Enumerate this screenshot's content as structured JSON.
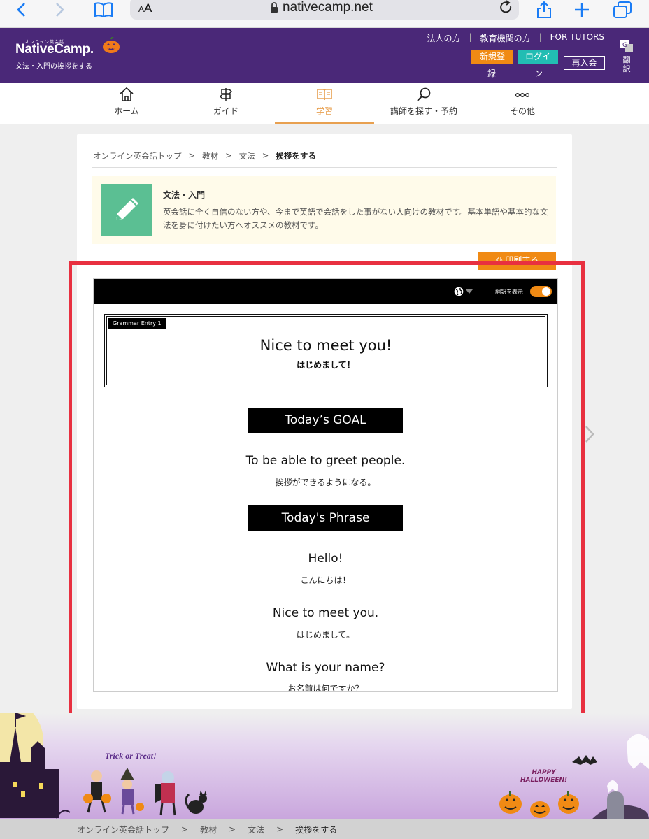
{
  "browser": {
    "aa_label": "AA",
    "url": "nativecamp.net"
  },
  "header": {
    "logo_small": "オンライン英会話",
    "logo_text": "NativeCamp.",
    "page_subtitle": "文法・入門の挨拶をする",
    "links": [
      "法人の方",
      "教育機関の方",
      "FOR TUTORS"
    ],
    "register_label_1": "新規登",
    "register_label_2": "録",
    "login_label_1": "ログイ",
    "login_label_2": "ン",
    "rejoin_label": "再入会",
    "translate_1": "翻",
    "translate_2": "訳"
  },
  "nav": [
    {
      "label": "ホーム",
      "icon": "home-icon"
    },
    {
      "label": "ガイド",
      "icon": "signpost-icon"
    },
    {
      "label": "学習",
      "icon": "book-icon",
      "active": true
    },
    {
      "label": "講師を探す・予約",
      "icon": "search-icon"
    },
    {
      "label": "その他",
      "icon": "more-icon"
    }
  ],
  "breadcrumb": {
    "items": [
      "オンライン英会話トップ",
      "教材",
      "文法"
    ],
    "separator": ">",
    "current": "挨拶をする"
  },
  "course": {
    "title": "文法・入門",
    "description": "英会話に全く自信のない方や、今まで英語で会話をした事がない人向けの教材です。基本単語や基本的な文法を身に付けたい方へオススメの教材です。",
    "icon_color": "#5bbf93"
  },
  "print_label": "印刷する",
  "viewer": {
    "toggle_label": "翻訳を表示",
    "toggle_on": true,
    "entry_tag": "Grammar Entry 1",
    "entry_title": "Nice to meet you!",
    "entry_subtitle": "はじめまして！",
    "goal_heading": "Today’s GOAL",
    "goal_en": "To be able to greet people.",
    "goal_ja": "挨拶ができるようになる。",
    "phrase_heading": "Today's Phrase",
    "phrases": [
      {
        "en": "Hello!",
        "ja": "こんにちは！"
      },
      {
        "en": "Nice to meet you.",
        "ja": "はじめまして。"
      },
      {
        "en": "What is your name?",
        "ja": "お名前は何ですか？"
      }
    ]
  },
  "halloween": {
    "trick": "Trick or Treat!",
    "happy_1": "HAPPY",
    "happy_2": "HALLOWEEN!"
  },
  "footer_breadcrumb": {
    "items": [
      "オンライン英会話トップ",
      "教材",
      "文法"
    ],
    "separator": ">",
    "current": "挨拶をする"
  },
  "colors": {
    "header_purple": "#4a2878",
    "accent_orange": "#f08a14",
    "login_teal": "#22bdb3",
    "highlight_red": "#e83040"
  }
}
